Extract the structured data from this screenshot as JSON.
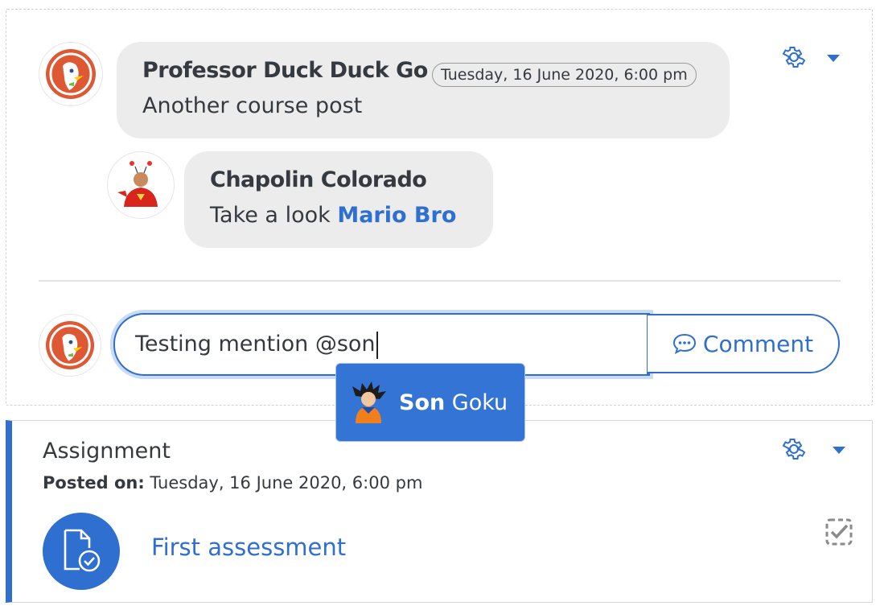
{
  "post": {
    "author": "Professor Duck Duck Go",
    "timestamp": "Tuesday, 16 June 2020, 6:00 pm",
    "body": "Another course post"
  },
  "reply": {
    "author": "Chapolin Colorado",
    "body_prefix": "Take a look ",
    "mention": "Mario Bro"
  },
  "comment_box": {
    "value": "Testing mention @son",
    "button_label": "Comment"
  },
  "mention_suggestion": {
    "match": "Son",
    "rest": " Goku"
  },
  "assignment": {
    "type_label": "Assignment",
    "posted_on_label": "Posted on:",
    "posted_on_value": " Tuesday, 16 June 2020, 6:00 pm",
    "link_text": "First assessment"
  },
  "colors": {
    "accent": "#2f6fcf",
    "bubble": "#ececec",
    "suggestion_bg": "#3474d4"
  }
}
